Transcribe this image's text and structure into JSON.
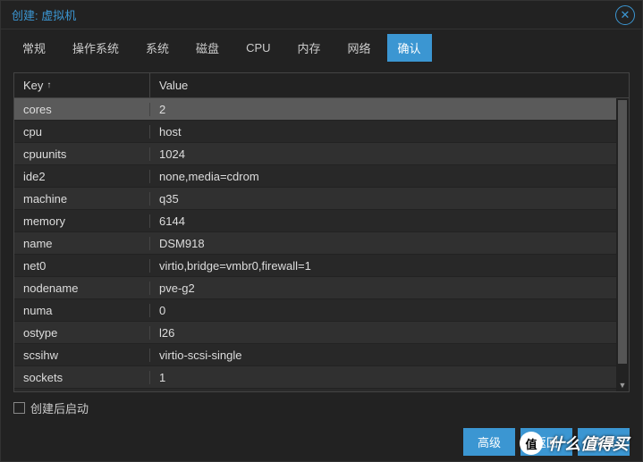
{
  "title": "创建: 虚拟机",
  "tabs": [
    "常规",
    "操作系统",
    "系统",
    "磁盘",
    "CPU",
    "内存",
    "网络",
    "确认"
  ],
  "active_tab_index": 7,
  "columns": {
    "key": "Key",
    "value": "Value"
  },
  "rows": [
    {
      "key": "cores",
      "value": "2"
    },
    {
      "key": "cpu",
      "value": "host"
    },
    {
      "key": "cpuunits",
      "value": "1024"
    },
    {
      "key": "ide2",
      "value": "none,media=cdrom"
    },
    {
      "key": "machine",
      "value": "q35"
    },
    {
      "key": "memory",
      "value": "6144"
    },
    {
      "key": "name",
      "value": "DSM918"
    },
    {
      "key": "net0",
      "value": "virtio,bridge=vmbr0,firewall=1"
    },
    {
      "key": "nodename",
      "value": "pve-g2"
    },
    {
      "key": "numa",
      "value": "0"
    },
    {
      "key": "ostype",
      "value": "l26"
    },
    {
      "key": "scsihw",
      "value": "virtio-scsi-single"
    },
    {
      "key": "sockets",
      "value": "1"
    }
  ],
  "selected_row_index": 0,
  "footer": {
    "check_label": "创建后启动",
    "checked": false,
    "advanced": "高级",
    "back": "返回",
    "finish": "完成"
  },
  "watermark": {
    "icon": "值",
    "text": "什么值得买"
  }
}
